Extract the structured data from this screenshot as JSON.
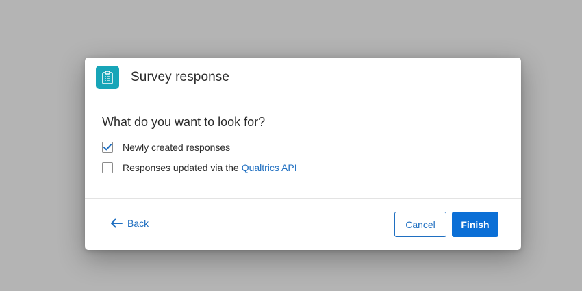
{
  "dialog": {
    "title": "Survey response",
    "icon": "clipboard-list-icon",
    "accent_color": "#17a5b8"
  },
  "body": {
    "question": "What do you want to look for?",
    "options": [
      {
        "label": "Newly created responses",
        "checked": true
      },
      {
        "label": "Responses updated via the",
        "link": "Qualtrics API",
        "checked": false
      }
    ]
  },
  "footer": {
    "back_label": "Back",
    "cancel_label": "Cancel",
    "finish_label": "Finish",
    "primary_color": "#0b6fd6"
  }
}
